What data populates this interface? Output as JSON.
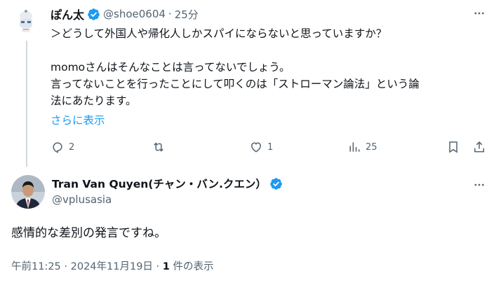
{
  "reply": {
    "author_name": "ぽん太",
    "handle": "@shoe0604",
    "separator": "·",
    "time": "25分",
    "text_lines": [
      "＞どうして外国人や帰化人しかスパイにならないと思っていますか？",
      "",
      "momoさんはそんなことは言ってないでしょう。",
      "言ってないことを行ったことにして叩くのは「ストローマン論法」という論",
      "法にあたります。"
    ],
    "show_more": "さらに表示",
    "actions": {
      "replies": "2",
      "reposts": "",
      "likes": "1",
      "views": "25"
    }
  },
  "main_post": {
    "author_name": "Tran Van Quyen(チャン・バン.クエン）",
    "handle": "@vplusasia",
    "text": "感情的な差別の発言ですね。",
    "timestamp": "午前11:25 · 2024年11月19日 · ",
    "view_count": "1",
    "view_label": " 件の表示"
  },
  "colors": {
    "verified": "#1d9bf0",
    "link": "#1d9bf0",
    "secondary_text": "#536471",
    "thread_line": "#cfd9de"
  },
  "icons": [
    "verified-badge-icon",
    "more-icon",
    "reply-icon",
    "repost-icon",
    "like-icon",
    "views-icon",
    "bookmark-icon",
    "share-icon"
  ]
}
